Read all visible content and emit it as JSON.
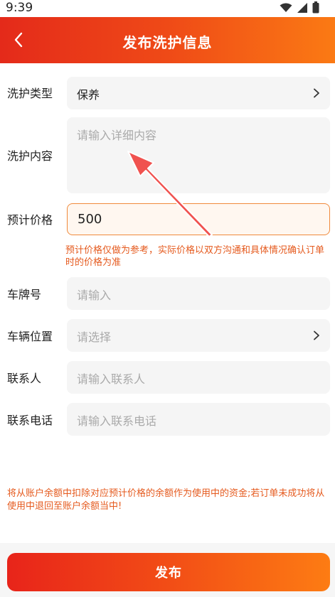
{
  "status_bar": {
    "time": "9:39"
  },
  "header": {
    "title": "发布洗护信息"
  },
  "form": {
    "wash_type": {
      "label": "洗护类型",
      "value": "保养"
    },
    "wash_content": {
      "label": "洗护内容",
      "placeholder": "请输入详细内容"
    },
    "price": {
      "label": "预计价格",
      "value": "500",
      "note": "预计价格仅做为参考，实际价格以双方沟通和具体情况确认订单时的价格为准"
    },
    "plate": {
      "label": "车牌号",
      "placeholder": "请输入"
    },
    "location": {
      "label": "车辆位置",
      "placeholder": "请选择"
    },
    "contact": {
      "label": "联系人",
      "placeholder": "请输入联系人"
    },
    "phone": {
      "label": "联系电话",
      "placeholder": "请输入联系电话"
    }
  },
  "bottom_note": "将从账户余额中扣除对应预计价格的余额作为使用中的资金;若订单未成功将从使用中退回至账户余额当中!",
  "publish_button": {
    "label": "发布"
  },
  "colors": {
    "header_gradient_start": "#e42a1a",
    "header_gradient_end": "#fb7a14",
    "note_text": "#e55a1e",
    "annotation_arrow": "#f0524f"
  }
}
